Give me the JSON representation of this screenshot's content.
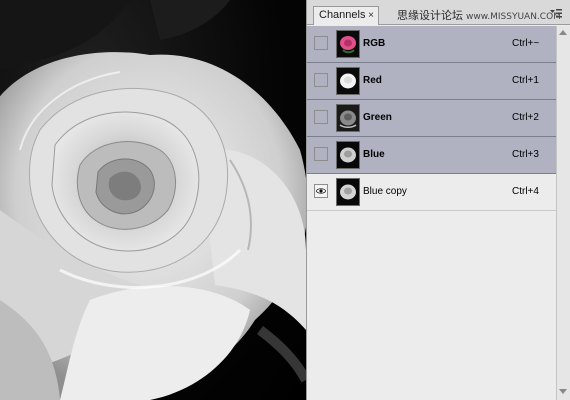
{
  "canvas": {
    "description_icon": "rose-image"
  },
  "panel": {
    "tab_label": "Channels",
    "tab_close": "×",
    "watermark_cn": "思缘设计论坛",
    "watermark_site": "www.MISSYUAN.COM",
    "channels": [
      {
        "name": "RGB",
        "shortcut": "Ctrl+~",
        "visible": false,
        "selected": true,
        "thumb": "rgb-color-thumb"
      },
      {
        "name": "Red",
        "shortcut": "Ctrl+1",
        "visible": false,
        "selected": true,
        "thumb": "red-gray-thumb"
      },
      {
        "name": "Green",
        "shortcut": "Ctrl+2",
        "visible": false,
        "selected": true,
        "thumb": "green-gray-thumb"
      },
      {
        "name": "Blue",
        "shortcut": "Ctrl+3",
        "visible": false,
        "selected": true,
        "thumb": "blue-gray-thumb"
      },
      {
        "name": "Blue copy",
        "shortcut": "Ctrl+4",
        "visible": true,
        "selected": false,
        "thumb": "blue-copy-thumb"
      }
    ]
  },
  "colors": {
    "selected_row": "#b0b2c2",
    "panel_bg": "#ececec",
    "rgb_thumb_pink": "#e0508a"
  }
}
